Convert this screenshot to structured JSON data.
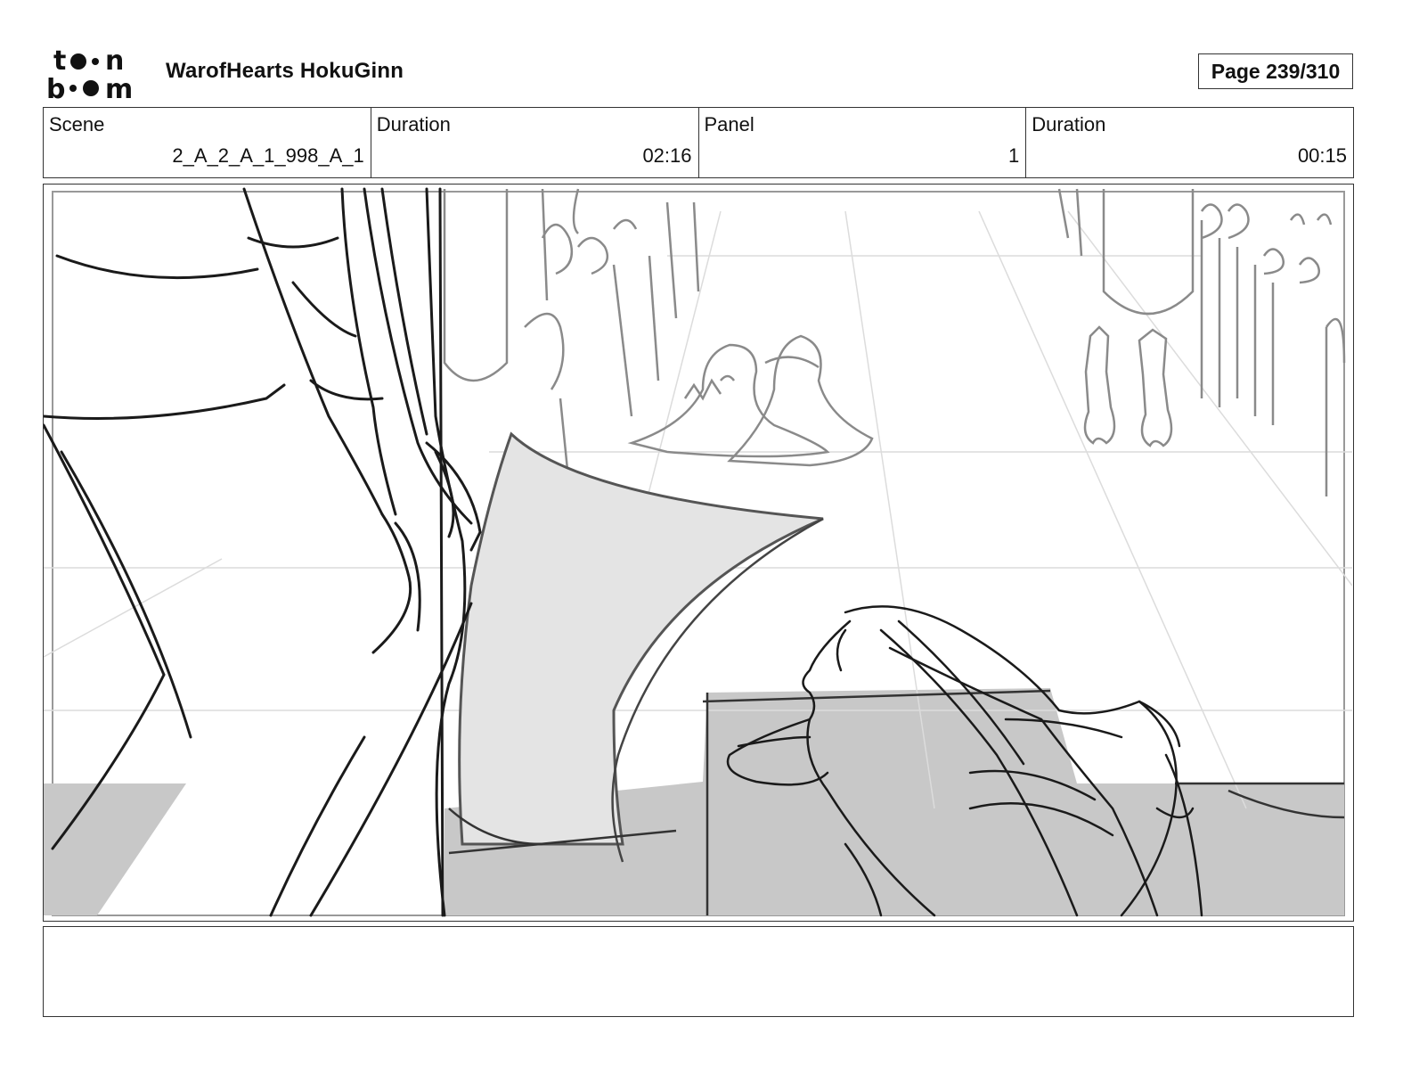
{
  "header": {
    "logo_alt": "toon boom",
    "project_title": "WarofHearts HokuGinn",
    "page_label": "Page 239/310"
  },
  "info": {
    "scene_label": "Scene",
    "scene_value": "2_A_2_A_1_998_A_1",
    "scene_duration_label": "Duration",
    "scene_duration_value": "02:16",
    "panel_label": "Panel",
    "panel_value": "1",
    "panel_duration_label": "Duration",
    "panel_duration_value": "00:15"
  },
  "colors": {
    "border": "#333333",
    "sketch_line": "#1a1a1a",
    "background_line": "#9a9a9a",
    "floor_shade": "#c8c8c8",
    "cloth_shade": "#e4e4e4"
  },
  "notes": ""
}
